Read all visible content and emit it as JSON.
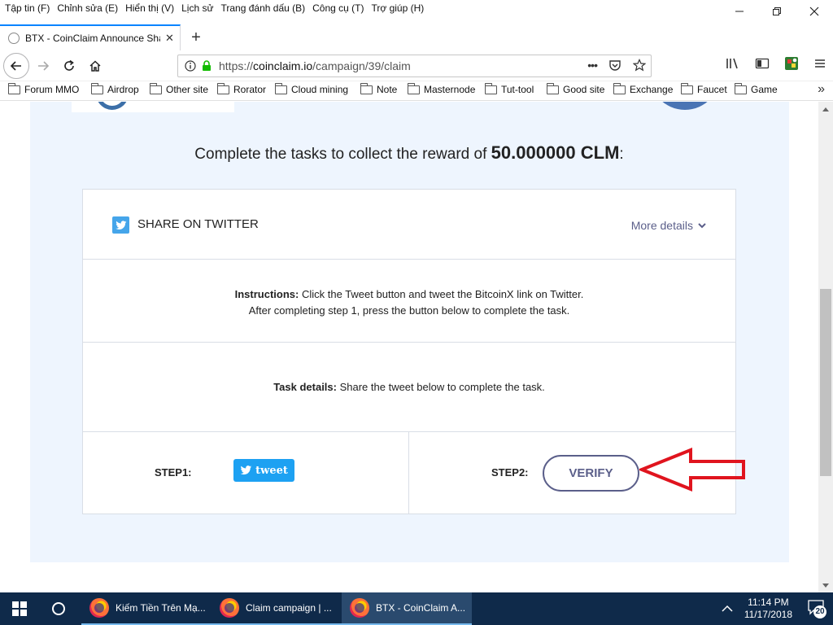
{
  "menu": [
    "Tập tin (F)",
    "Chỉnh sửa (E)",
    "Hiển thị (V)",
    "Lịch sử",
    "Trang đánh dấu (B)",
    "Công cụ (T)",
    "Trợ giúp (H)"
  ],
  "tab": {
    "title": "BTX - CoinClaim Announce Sha",
    "close": "✕"
  },
  "newtab": "+",
  "url": {
    "prefix": "https://",
    "host": "coinclaim.io",
    "path": "/campaign/39/claim",
    "page_actions": "•••"
  },
  "bookmarks": [
    "Forum MMO",
    "Airdrop",
    "Other site",
    "Rorator",
    "Cloud mining",
    "Note",
    "Masternode",
    "Tut-tool",
    "Good site",
    "Exchange",
    "Faucet",
    "Game"
  ],
  "page": {
    "reward_prefix": "Complete the tasks to collect the reward of ",
    "reward_amount": "50.000000 CLM",
    "reward_suffix": ":",
    "share_title": "SHARE ON TWITTER",
    "more_details": "More details",
    "instructions_label": "Instructions:",
    "instructions_line1": " Click the Tweet button and tweet the BitcoinX link on Twitter.",
    "instructions_line2": "After completing step 1, press the button below to complete the task.",
    "task_label": "Task details:",
    "task_text": " Share the tweet below to complete the task.",
    "step1": "STEP1:",
    "tweet": "tweet",
    "step2": "STEP2:",
    "verify": "VERIFY"
  },
  "taskbar": {
    "items": [
      "Kiếm Tiền Trên Mạ...",
      "Claim campaign | ...",
      "BTX - CoinClaim A..."
    ],
    "time": "11:14 PM",
    "date": "11/17/2018",
    "notifications": "20"
  },
  "colors": {
    "accent": "#5b5f8a",
    "twitter": "#1da1f2",
    "arrow": "#e0141e",
    "panel": "#eef5fe"
  }
}
